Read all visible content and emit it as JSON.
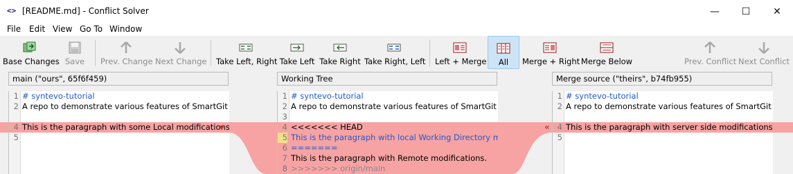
{
  "window": {
    "icon": "<>",
    "title": "[README.md] - Conflict Solver",
    "controls": {
      "minimize": "—",
      "maximize": "☐",
      "close": "✕"
    }
  },
  "menu": [
    "File",
    "Edit",
    "View",
    "Go To",
    "Window"
  ],
  "toolbar": {
    "base_changes": "Base Changes",
    "save": "Save",
    "prev_change": "Prev. Change",
    "next_change": "Next Change",
    "take_left_right": "Take Left, Right",
    "take_left": "Take Left",
    "take_right": "Take Right",
    "take_right_left": "Take Right, Left",
    "left_merge": "Left + Merge",
    "all": "All",
    "merge_right": "Merge + Right",
    "merge_below": "Merge Below",
    "prev_conflict": "Prev. Conflict",
    "next_conflict": "Next Conflict"
  },
  "panes": {
    "left": {
      "header": "main (\"ours\", 65f6f459)",
      "lines": [
        {
          "num": "1",
          "text": "# syntevo-tutorial"
        },
        {
          "num": "2",
          "text": "A repo to demonstrate various features of SmartGit for th"
        },
        {
          "num": "4",
          "text": "This is the paragraph with some Local modifications."
        },
        {
          "num": "5",
          "text": ""
        }
      ],
      "marker": "»"
    },
    "center": {
      "header": "Working Tree",
      "lines": [
        {
          "num": "1",
          "text": "# syntevo-tutorial"
        },
        {
          "num": "2",
          "text": "A repo to demonstrate various features of SmartGit for th"
        },
        {
          "num": "3",
          "text": ""
        },
        {
          "num": "4",
          "text": "<<<<<<< HEAD"
        },
        {
          "num": "5",
          "text": "This is the paragraph with local Working Directory modif"
        },
        {
          "num": "6",
          "text": "======="
        },
        {
          "num": "7",
          "text": "This is the paragraph with Remote modifications."
        },
        {
          "num": "8",
          "text": ">>>>>>> origin/main"
        }
      ]
    },
    "right": {
      "header": "Merge source (\"theirs\", b74fb955)",
      "lines": [
        {
          "num": "1",
          "text": "# syntevo-tutorial"
        },
        {
          "num": "2",
          "text": "A repo to demonstrate various features of SmartGit for th"
        },
        {
          "num": "4",
          "text": "This is the paragraph with server side modifications."
        },
        {
          "num": "5",
          "text": ""
        }
      ],
      "marker": "«"
    }
  },
  "colors": {
    "conflict": "#f7a3a3",
    "heading": "#2458c8",
    "selected_tool": "#cde4f7"
  }
}
